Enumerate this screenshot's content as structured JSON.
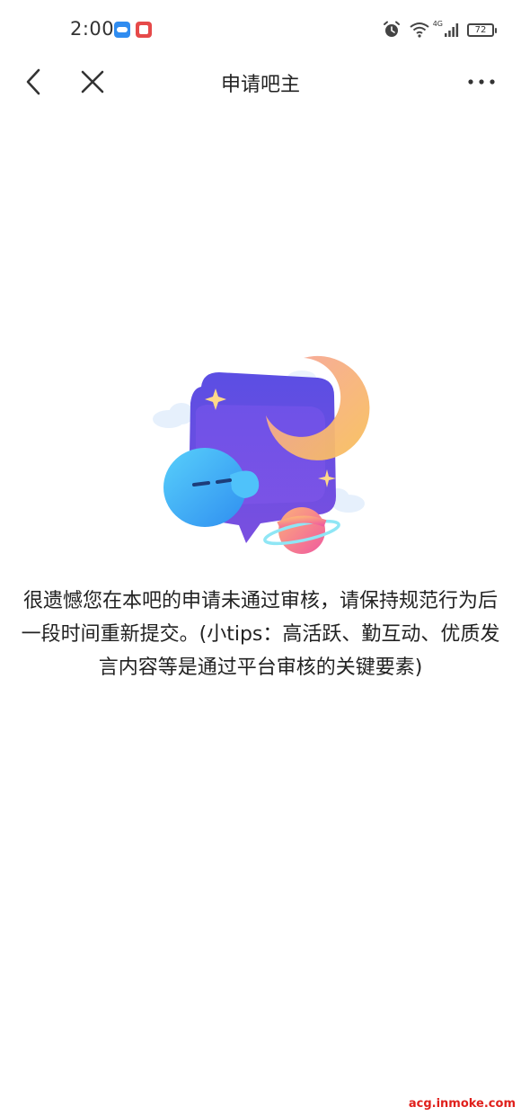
{
  "status_bar": {
    "time": "2:00",
    "network": "4G",
    "battery": "72",
    "icons": [
      "cloud-notification-icon",
      "app-notification-icon",
      "alarm-icon",
      "wifi-icon",
      "signal-icon",
      "battery-icon"
    ]
  },
  "nav": {
    "title": "申请吧主",
    "back_icon": "chevron-left-icon",
    "close_icon": "close-icon",
    "more_icon": "more-dots-icon"
  },
  "main": {
    "illustration": "speech-bubble-moon-planet-illustration",
    "message": "很遗憾您在本吧的申请未通过审核，请保持规范行为后一段时间重新提交。(小tips：高活跃、勤互动、优质发言内容等是通过平台审核的关键要素)"
  },
  "watermark": "acg.inmoke.com",
  "colors": {
    "bubble_purple": "#6a4fe6",
    "moon_orange": "#f8b25c",
    "planet_pink": "#f26aa0",
    "character_blue": "#3fb4f5"
  }
}
